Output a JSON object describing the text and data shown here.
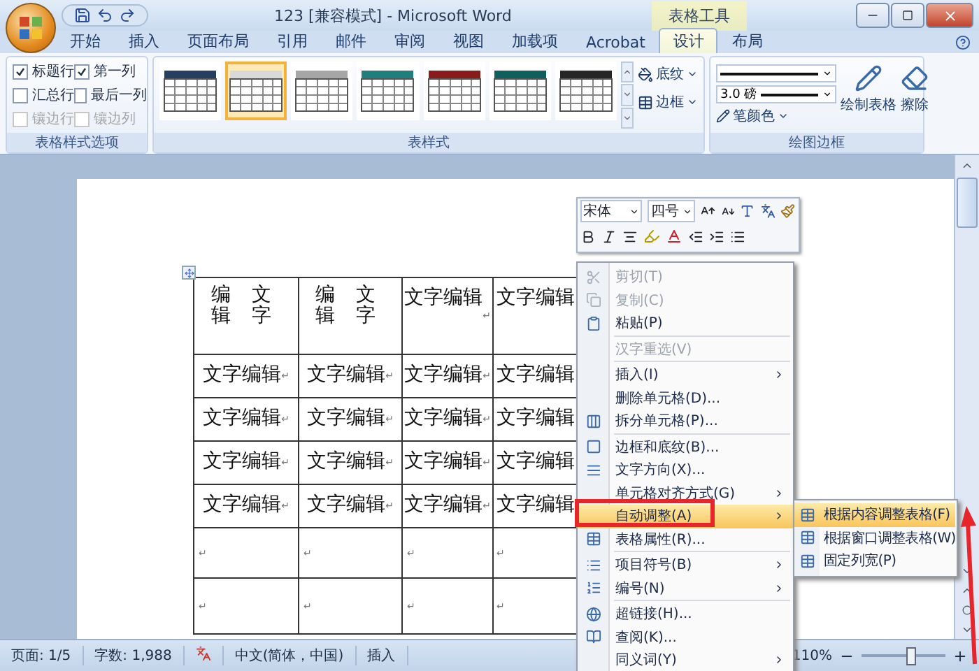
{
  "window": {
    "title": "123 [兼容模式] - Microsoft Word",
    "context_tab_group": "表格工具"
  },
  "tabs": [
    {
      "label": "开始",
      "selected": false
    },
    {
      "label": "插入",
      "selected": false
    },
    {
      "label": "页面布局",
      "selected": false
    },
    {
      "label": "引用",
      "selected": false
    },
    {
      "label": "邮件",
      "selected": false
    },
    {
      "label": "审阅",
      "selected": false
    },
    {
      "label": "视图",
      "selected": false
    },
    {
      "label": "加载项",
      "selected": false
    },
    {
      "label": "Acrobat",
      "selected": false
    },
    {
      "label": "设计",
      "selected": true
    },
    {
      "label": "布局",
      "selected": false
    }
  ],
  "ribbon": {
    "style_options": {
      "title": "表格样式选项",
      "items": [
        {
          "label": "标题行",
          "checked": true,
          "disabled": false
        },
        {
          "label": "第一列",
          "checked": true,
          "disabled": false
        },
        {
          "label": "汇总行",
          "checked": false,
          "disabled": false
        },
        {
          "label": "最后一列",
          "checked": false,
          "disabled": false
        },
        {
          "label": "镶边行",
          "checked": false,
          "disabled": true
        },
        {
          "label": "镶边列",
          "checked": false,
          "disabled": true
        }
      ]
    },
    "table_styles": {
      "title": "表样式",
      "shading": "底纹",
      "borders": "边框",
      "styles": [
        {
          "color": "#243f60",
          "selected": false
        },
        {
          "color": "#d9d9d9",
          "selected": true
        },
        {
          "color": "#a6a6a6",
          "selected": false
        },
        {
          "color": "#1f7f7f",
          "selected": false
        },
        {
          "color": "#8b1a1a",
          "selected": false
        },
        {
          "color": "#0f5f5f",
          "selected": false
        },
        {
          "color": "#262626",
          "selected": false
        }
      ]
    },
    "draw_borders": {
      "title": "绘图边框",
      "line_weight": "3.0 磅",
      "pen_color": "笔颜色",
      "draw_table": "绘制表格",
      "eraser": "擦除"
    }
  },
  "table": {
    "rows": [
      [
        {
          "kind": "vertical",
          "text": "编文辑字"
        },
        {
          "kind": "vertical",
          "text": "编文辑字"
        },
        {
          "kind": "text",
          "text": "文字编辑",
          "mark": "↵"
        },
        {
          "kind": "text",
          "text": "文字编辑"
        }
      ],
      [
        {
          "kind": "text",
          "text": "文字编辑",
          "mark": "↵"
        },
        {
          "kind": "text",
          "text": "文字编辑",
          "mark": "↵"
        },
        {
          "kind": "text",
          "text": "文字编辑",
          "mark": "↵"
        },
        {
          "kind": "text",
          "text": "文字编辑"
        }
      ],
      [
        {
          "kind": "text",
          "text": "文字编辑",
          "mark": "↵"
        },
        {
          "kind": "text",
          "text": "文字编辑",
          "mark": "↵"
        },
        {
          "kind": "text",
          "text": "文字编辑",
          "mark": "↵"
        },
        {
          "kind": "text",
          "text": "文字编辑"
        }
      ],
      [
        {
          "kind": "text",
          "text": "文字编辑",
          "mark": "↵"
        },
        {
          "kind": "text",
          "text": "文字编辑",
          "mark": "↵"
        },
        {
          "kind": "text",
          "text": "文字编辑",
          "mark": "↵"
        },
        {
          "kind": "text",
          "text": "文字编辑"
        }
      ],
      [
        {
          "kind": "text",
          "text": "文字编辑",
          "mark": "↵"
        },
        {
          "kind": "text",
          "text": "文字编辑",
          "mark": "↵"
        },
        {
          "kind": "text",
          "text": "文字编辑",
          "mark": "↵"
        },
        {
          "kind": "text",
          "text": "文字编辑"
        }
      ],
      [
        {
          "kind": "empty",
          "mark": "↵"
        },
        {
          "kind": "empty",
          "mark": "↵"
        },
        {
          "kind": "empty",
          "mark": "↵"
        },
        {
          "kind": "empty",
          "mark": "↵"
        }
      ],
      [
        {
          "kind": "empty",
          "mark": "↵"
        },
        {
          "kind": "empty",
          "mark": "↵"
        },
        {
          "kind": "empty",
          "mark": "↵"
        },
        {
          "kind": "empty",
          "mark": "↵"
        }
      ]
    ]
  },
  "mini_toolbar": {
    "font": "宋体",
    "size": "四号"
  },
  "context_menu": {
    "groups": [
      {
        "items": [
          {
            "label": "剪切(T)",
            "disabled": true,
            "submenu": false,
            "selected": false
          },
          {
            "label": "复制(C)",
            "disabled": true,
            "submenu": false,
            "selected": false
          },
          {
            "label": "粘贴(P)",
            "disabled": false,
            "submenu": false,
            "selected": false
          }
        ]
      },
      {
        "items": [
          {
            "label": "汉字重选(V)",
            "disabled": true,
            "submenu": false,
            "selected": false
          }
        ]
      },
      {
        "items": [
          {
            "label": "插入(I)",
            "disabled": false,
            "submenu": true,
            "selected": false
          },
          {
            "label": "删除单元格(D)...",
            "disabled": false,
            "submenu": false,
            "selected": false
          },
          {
            "label": "拆分单元格(P)...",
            "disabled": false,
            "submenu": false,
            "selected": false
          }
        ]
      },
      {
        "items": [
          {
            "label": "边框和底纹(B)...",
            "disabled": false,
            "submenu": false,
            "selected": false
          },
          {
            "label": "文字方向(X)...",
            "disabled": false,
            "submenu": false,
            "selected": false
          },
          {
            "label": "单元格对齐方式(G)",
            "disabled": false,
            "submenu": true,
            "selected": false
          },
          {
            "label": "自动调整(A)",
            "disabled": false,
            "submenu": true,
            "selected": true
          },
          {
            "label": "表格属性(R)...",
            "disabled": false,
            "submenu": false,
            "selected": false
          }
        ]
      },
      {
        "items": [
          {
            "label": "项目符号(B)",
            "disabled": false,
            "submenu": true,
            "selected": false
          },
          {
            "label": "编号(N)",
            "disabled": false,
            "submenu": true,
            "selected": false
          }
        ]
      },
      {
        "items": [
          {
            "label": "超链接(H)...",
            "disabled": false,
            "submenu": false,
            "selected": false
          },
          {
            "label": "查阅(K)...",
            "disabled": false,
            "submenu": false,
            "selected": false
          },
          {
            "label": "同义词(Y)",
            "disabled": false,
            "submenu": true,
            "selected": false
          }
        ]
      }
    ]
  },
  "submenu": {
    "items": [
      {
        "label": "根据内容调整表格(F)",
        "selected": true
      },
      {
        "label": "根据窗口调整表格(W)",
        "selected": false
      },
      {
        "label": "固定列宽(P)",
        "selected": false
      }
    ]
  },
  "status_bar": {
    "page": "页面: 1/5",
    "words": "字数: 1,988",
    "language": "中文(简体，中国)",
    "mode": "插入",
    "zoom": {
      "reading": "110%",
      "level": 0.58
    }
  }
}
